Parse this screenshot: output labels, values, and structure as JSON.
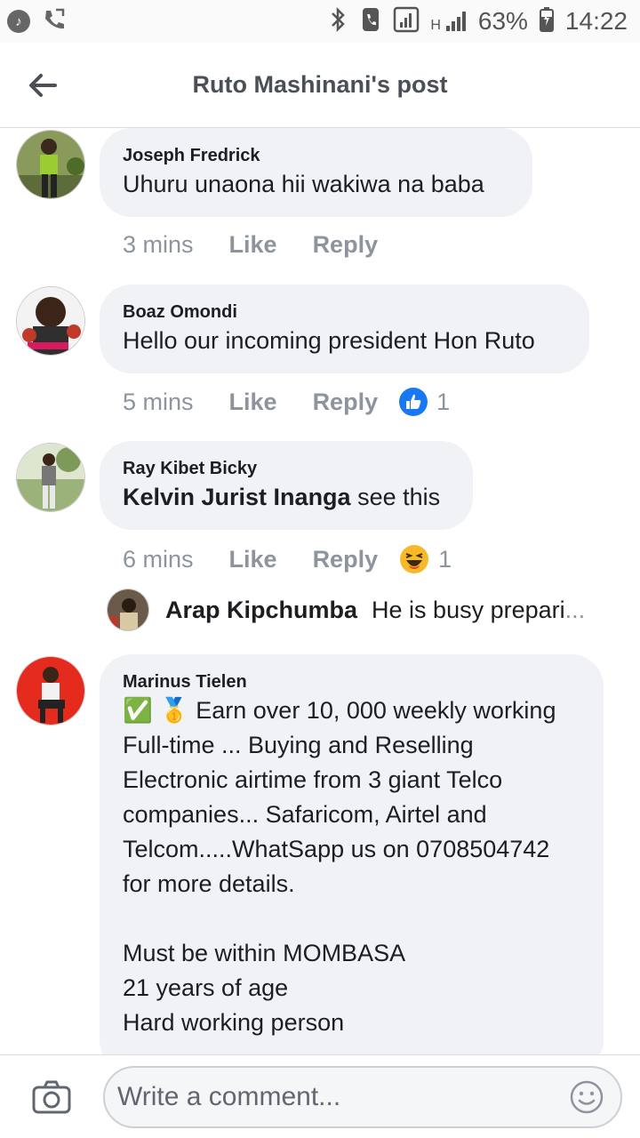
{
  "status_bar": {
    "battery": "63%",
    "time": "14:22",
    "network": "H"
  },
  "header": {
    "title": "Ruto Mashinani's post"
  },
  "comments": [
    {
      "author": "Joseph Fredrick",
      "text": "Uhuru unaona hii wakiwa na baba",
      "time": "3 mins",
      "like_label": "Like",
      "reply_label": "Reply"
    },
    {
      "author": "Boaz Omondi",
      "text": "Hello our incoming president Hon Ruto",
      "time": "5 mins",
      "like_label": "Like",
      "reply_label": "Reply",
      "reaction": {
        "icon": "thumbs-up",
        "count": "1"
      }
    },
    {
      "author": "Ray Kibet Bicky",
      "mention": "Kelvin Jurist Inanga",
      "text": " see this",
      "time": "6 mins",
      "like_label": "Like",
      "reply_label": "Reply",
      "reaction": {
        "icon": "haha",
        "count": "1"
      },
      "reply_preview": {
        "author": "Arap Kipchumba",
        "text": "He is busy prepari",
        "ellipsis": "..."
      }
    },
    {
      "author": "Marinus Tielen",
      "prefix_emojis": "✅ 🥇 ",
      "text": "Earn over 10, 000 weekly working\nFull-time ... Buying and Reselling\nElectronic airtime from 3 giant Telco\ncompanies... Safaricom, Airtel and\nTelcom.....WhatSapp us on 0708504742\nfor more details.\n\nMust be within MOMBASA\n21 years of age\nHard working person"
    }
  ],
  "composer": {
    "placeholder": "Write a comment..."
  },
  "colors": {
    "bubble": "#f0f2f5",
    "muted": "#8d949e",
    "like_blue": "#1877f2",
    "text": "#1c1e21"
  }
}
